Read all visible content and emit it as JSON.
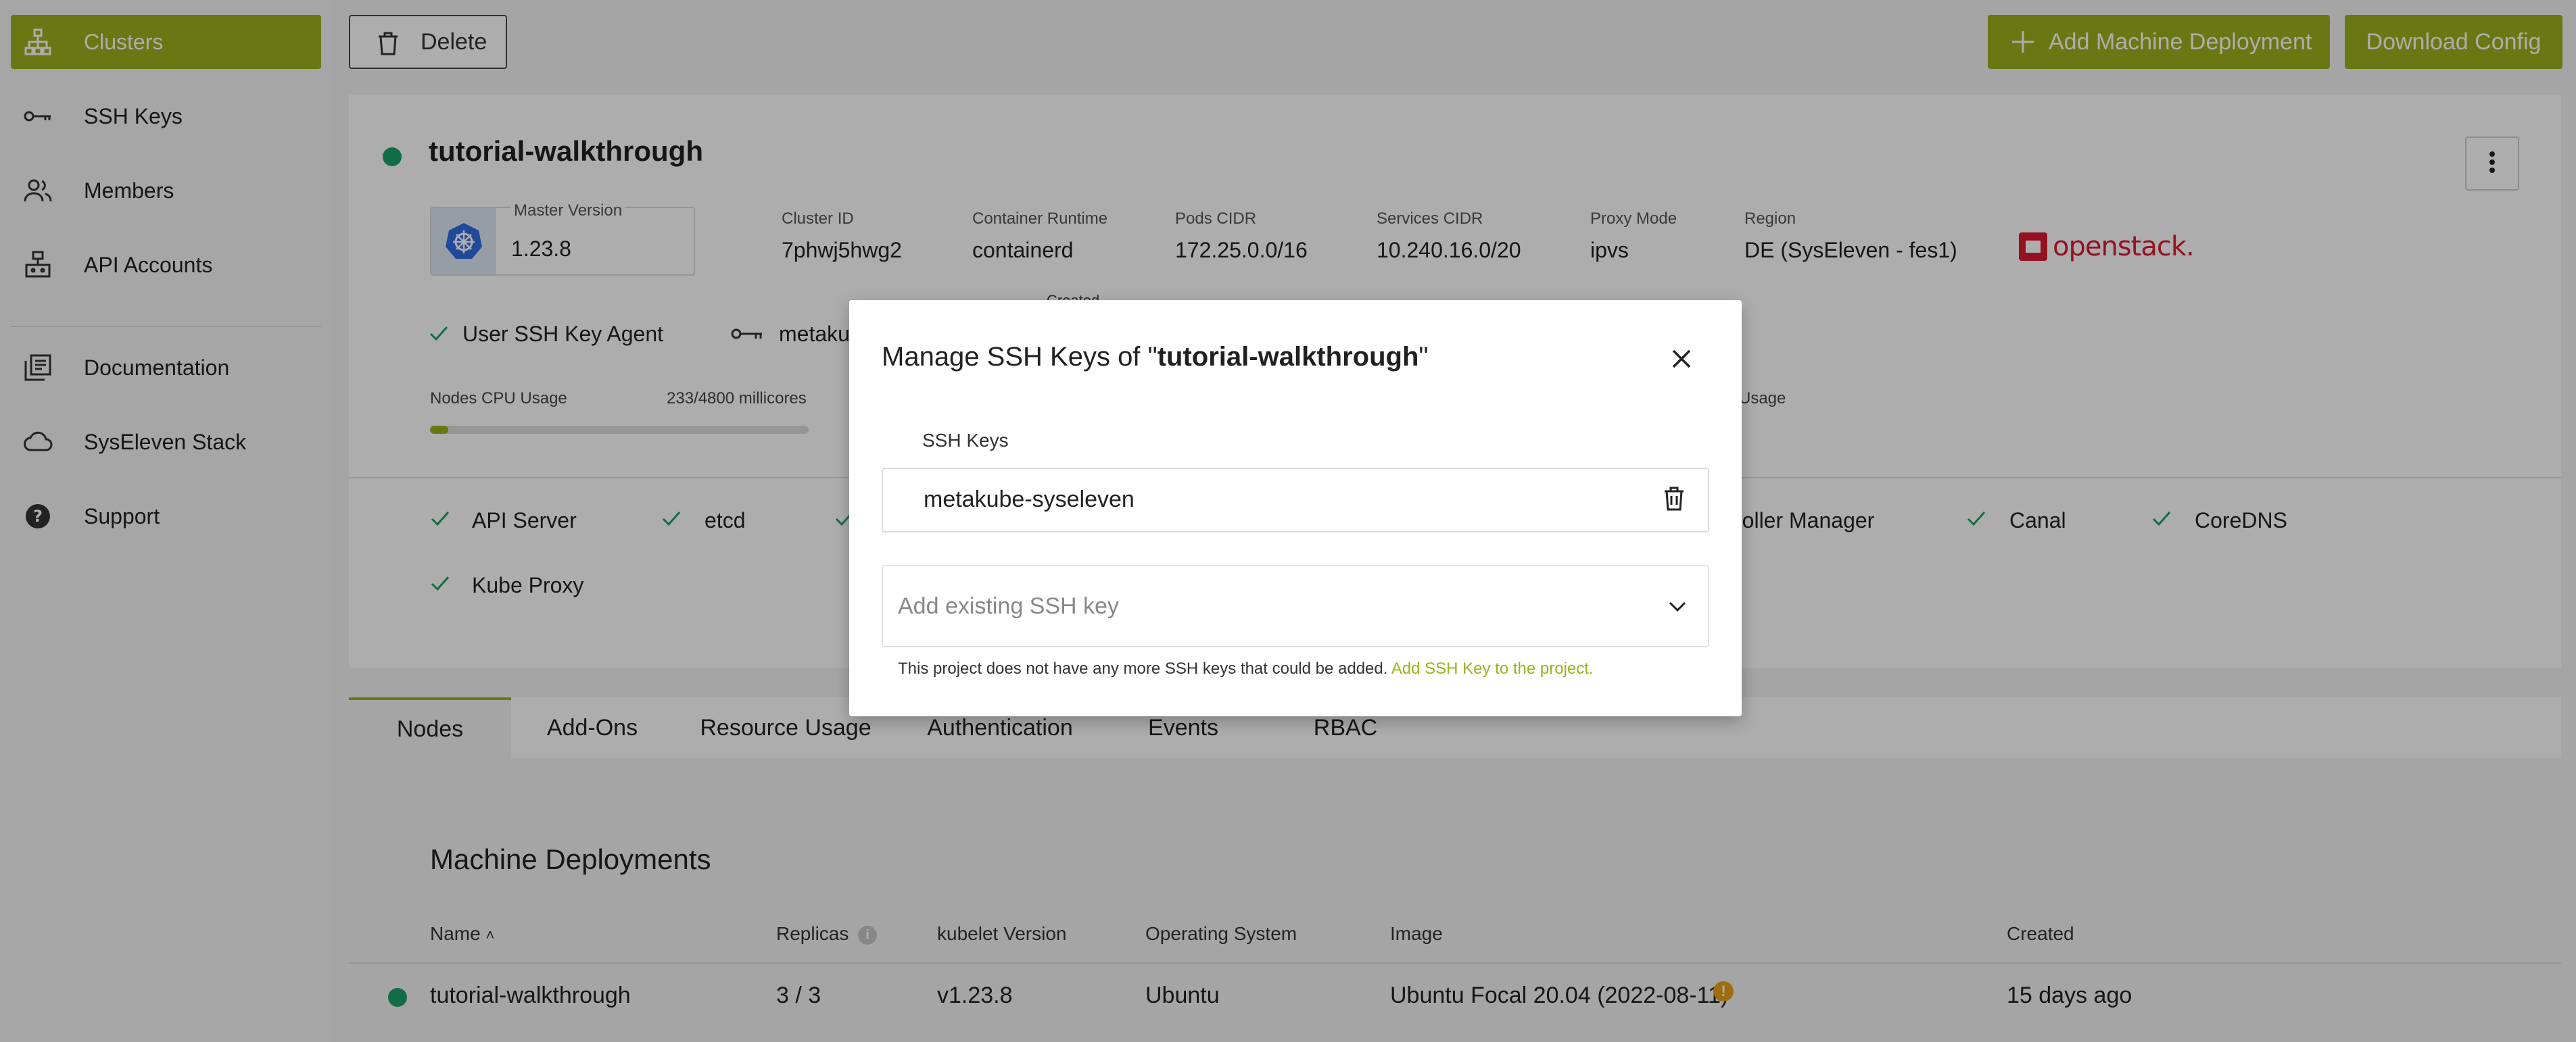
{
  "sidebar": {
    "items": [
      {
        "label": "Clusters",
        "icon": "clusters-icon",
        "active": true
      },
      {
        "label": "SSH Keys",
        "icon": "key-icon"
      },
      {
        "label": "Members",
        "icon": "members-icon"
      },
      {
        "label": "API Accounts",
        "icon": "api-accounts-icon"
      },
      {
        "label": "Documentation",
        "icon": "documentation-icon"
      },
      {
        "label": "SysEleven Stack",
        "icon": "cloud-icon"
      },
      {
        "label": "Support",
        "icon": "help-icon"
      }
    ]
  },
  "toolbar": {
    "delete_label": "Delete",
    "add_md_label": "Add Machine Deployment",
    "download_label": "Download Config"
  },
  "cluster": {
    "name": "tutorial-walkthrough",
    "status_color": "#1aa167",
    "master_version_label": "Master Version",
    "master_version": "1.23.8",
    "cluster_id_label": "Cluster ID",
    "cluster_id": "7phwj5hwg2",
    "runtime_label": "Container Runtime",
    "runtime": "containerd",
    "pods_cidr_label": "Pods CIDR",
    "pods_cidr": "172.25.0.0/16",
    "services_cidr_label": "Services CIDR",
    "services_cidr": "10.240.16.0/20",
    "proxy_mode_label": "Proxy Mode",
    "proxy_mode": "ipvs",
    "region_label": "Region",
    "region": "DE (SysEleven - fes1)",
    "provider": "openstack.",
    "ssh_agent": "User SSH Key Agent",
    "ssh_key_partial": "metaku",
    "created_partial": "Created",
    "cpu_label": "Nodes CPU Usage",
    "cpu_value": "233/4800 millicores",
    "cpu_fraction": 0.0485,
    "usage_partial": "Usage"
  },
  "health": {
    "items": [
      "API Server",
      "etcd",
      "roller Manager",
      "Canal",
      "CoreDNS",
      "Kube Proxy"
    ]
  },
  "tabs": [
    "Nodes",
    "Add-Ons",
    "Resource Usage",
    "Authentication",
    "Events",
    "RBAC"
  ],
  "machine_deployments": {
    "title": "Machine Deployments",
    "columns": [
      "Name",
      "Replicas",
      "kubelet Version",
      "Operating System",
      "Image",
      "Created"
    ],
    "rows": [
      {
        "name": "tutorial-walkthrough",
        "replicas": "3 / 3",
        "kubelet": "v1.23.8",
        "os": "Ubuntu",
        "image": "Ubuntu Focal 20.04 (2022-08-11)",
        "created": "15 days ago"
      }
    ]
  },
  "modal": {
    "title_prefix": "Manage SSH Keys of \"",
    "title_name": "tutorial-walkthrough",
    "title_suffix": "\"",
    "ssh_keys_label": "SSH Keys",
    "key": "metakube-syseleven",
    "select_placeholder": "Add existing SSH key",
    "hint": "This project does not have any more SSH keys that could be added.",
    "hint_link": "Add SSH Key to the project."
  },
  "colors": {
    "accent": "#9cb21c",
    "status_ok": "#1aa167",
    "warning": "#e8a317"
  }
}
